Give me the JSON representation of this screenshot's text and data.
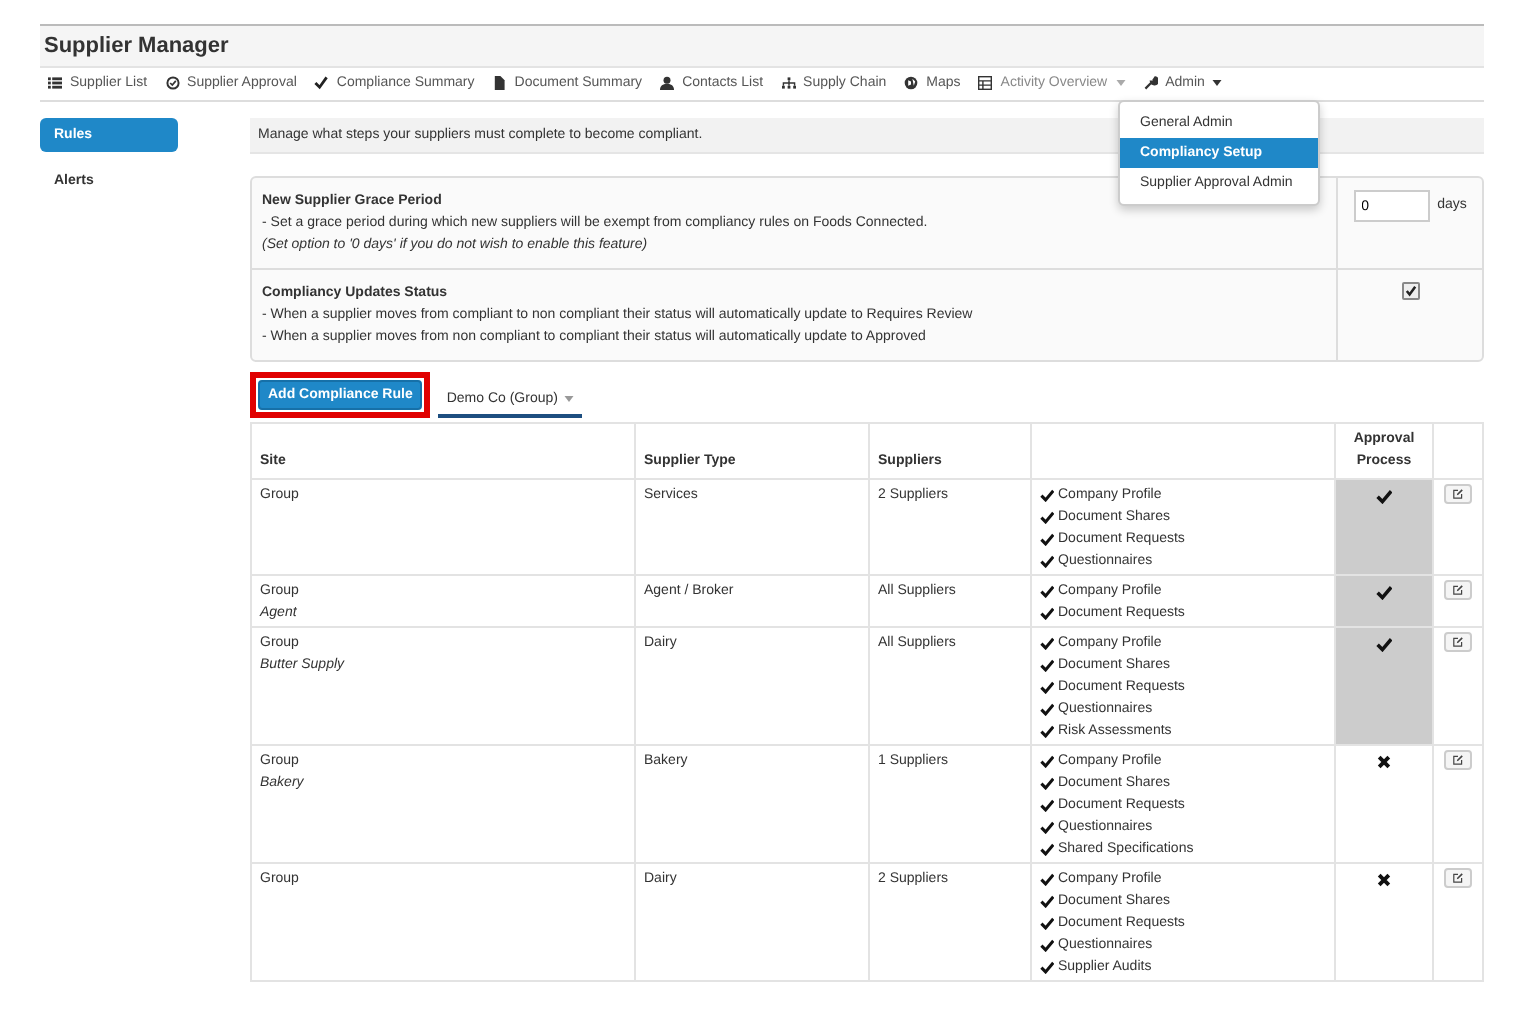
{
  "app_title": "Supplier Manager",
  "nav": [
    {
      "label": "Supplier List",
      "kind": "link",
      "disabled": false
    },
    {
      "label": "Supplier Approval",
      "kind": "link",
      "disabled": false
    },
    {
      "label": "Compliance Summary",
      "kind": "link",
      "disabled": false
    },
    {
      "label": "Document Summary",
      "kind": "link",
      "disabled": false
    },
    {
      "label": "Contacts List",
      "kind": "link",
      "disabled": false
    },
    {
      "label": "Supply Chain",
      "kind": "link",
      "disabled": false
    },
    {
      "label": "Maps",
      "kind": "link",
      "disabled": false
    },
    {
      "label": "Activity Overview",
      "kind": "dropdown",
      "disabled": true
    },
    {
      "label": "Admin",
      "kind": "dropdown",
      "disabled": false
    }
  ],
  "admin_menu": [
    {
      "label": "General Admin",
      "selected": false
    },
    {
      "label": "Compliancy Setup",
      "selected": true
    },
    {
      "label": "Supplier Approval Admin",
      "selected": false
    }
  ],
  "sidebar": [
    {
      "label": "Rules",
      "selected": true
    },
    {
      "label": "Alerts",
      "selected": false
    }
  ],
  "intro": "Manage what steps your suppliers must complete to become compliant.",
  "settings": [
    {
      "kind": "number",
      "title": "New Supplier Grace Period",
      "lines": [
        "- Set a grace period during which new suppliers will be exempt from compliancy rules on Foods Connected."
      ],
      "note": "(Set option to '0 days' if you do not wish to enable this feature)",
      "value": "0",
      "unit": "days"
    },
    {
      "kind": "checkbox",
      "title": "Compliancy Updates Status",
      "lines": [
        "- When a supplier moves from compliant to non compliant their status will automatically update to Requires Review",
        "- When a supplier moves from non compliant to compliant their status will automatically update to Approved"
      ],
      "checked": true
    }
  ],
  "add_button": "Add Compliance Rule",
  "group_select": "Demo Co (Group)",
  "table": {
    "columns": [
      "Site",
      "Supplier Type",
      "Suppliers",
      "Approval Process"
    ],
    "rows": [
      {
        "site": "Group",
        "type": "Services",
        "suppliers": "2 Suppliers",
        "steps": [
          "Company Profile",
          "Document Shares",
          "Document Requests",
          "Questionnaires"
        ],
        "approval": true
      },
      {
        "site": "Group",
        "subsite": "Agent",
        "type": "Agent / Broker",
        "suppliers": "All Suppliers",
        "steps": [
          "Company Profile",
          "Document Requests"
        ],
        "approval": true
      },
      {
        "site": "Group",
        "subsite": "Butter Supply",
        "type": "Dairy",
        "suppliers": "All Suppliers",
        "steps": [
          "Company Profile",
          "Document Shares",
          "Document Requests",
          "Questionnaires",
          "Risk Assessments"
        ],
        "approval": true
      },
      {
        "site": "Group",
        "subsite": "Bakery",
        "type": "Bakery",
        "suppliers": "1 Suppliers",
        "steps": [
          "Company Profile",
          "Document Shares",
          "Document Requests",
          "Questionnaires",
          "Shared Specifications"
        ],
        "approval": false
      },
      {
        "site": "Group",
        "type": "Dairy",
        "suppliers": "2 Suppliers",
        "steps": [
          "Company Profile",
          "Document Shares",
          "Document Requests",
          "Questionnaires",
          "Supplier Audits"
        ],
        "approval": false
      }
    ]
  }
}
